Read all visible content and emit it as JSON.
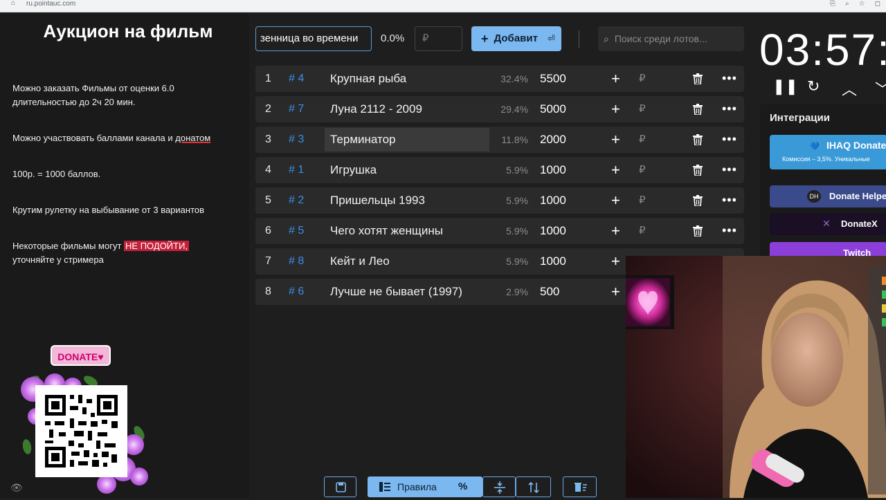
{
  "browser": {
    "url": "ru.pointauc.com"
  },
  "sidebar": {
    "title": "Аукцион на фильм",
    "rules": [
      "Можно заказать Фильмы от оценки 6.0 длительностью до 2ч 20 мин.",
      "Можно участвовать баллами канала и ",
      "донатом",
      "100р. = 1000 баллов.",
      "Крутим рулетку на выбывание от 3 вариантов",
      "Некоторые фильмы могут ",
      "НЕ ПОДОЙТИ,",
      "уточняйте у стримера"
    ],
    "donate_label": "DONATE♥"
  },
  "toolbar": {
    "name_value": "зенница во времени",
    "percent": "0.0%",
    "amount_placeholder": "₽",
    "add_label": "Добавит",
    "search_placeholder": "Поиск среди лотов..."
  },
  "lots": [
    {
      "num": "1",
      "tag": "# 4",
      "name": "Крупная рыба",
      "percent": "32.4%",
      "value": "5500"
    },
    {
      "num": "2",
      "tag": "# 7",
      "name": "Луна 2112 - 2009",
      "percent": "29.4%",
      "value": "5000"
    },
    {
      "num": "3",
      "tag": "# 3",
      "name": "Терминатор",
      "percent": "11.8%",
      "value": "2000"
    },
    {
      "num": "4",
      "tag": "# 1",
      "name": "Игрушка",
      "percent": "5.9%",
      "value": "1000"
    },
    {
      "num": "5",
      "tag": "# 2",
      "name": "Пришельцы 1993",
      "percent": "5.9%",
      "value": "1000"
    },
    {
      "num": "6",
      "tag": "# 5",
      "name": "Чего хотят женщины",
      "percent": "5.9%",
      "value": "1000"
    },
    {
      "num": "7",
      "tag": "# 8",
      "name": "Кейт и Лео",
      "percent": "5.9%",
      "value": "1000"
    },
    {
      "num": "8",
      "tag": "# 6",
      "name": "Лучше не бывает (1997)",
      "percent": "2.9%",
      "value": "500"
    }
  ],
  "bottom": {
    "rules_label": "Правила",
    "percent_icon": "%"
  },
  "timer": {
    "display": "03:57:"
  },
  "integrations": {
    "title": "Интеграции",
    "ihaq": "IHAQ Donate",
    "ihaq_sub": "Комиссия – 3,5%. Уникальные",
    "donatehelper": "Donate Helpe",
    "donatex": "DonateX",
    "twitch": "Twitch"
  },
  "colors": {
    "accent": "#7cb8f0",
    "tag": "#3a8ee6",
    "highlight": "#c4203a",
    "bg": "#1e1e1e"
  }
}
